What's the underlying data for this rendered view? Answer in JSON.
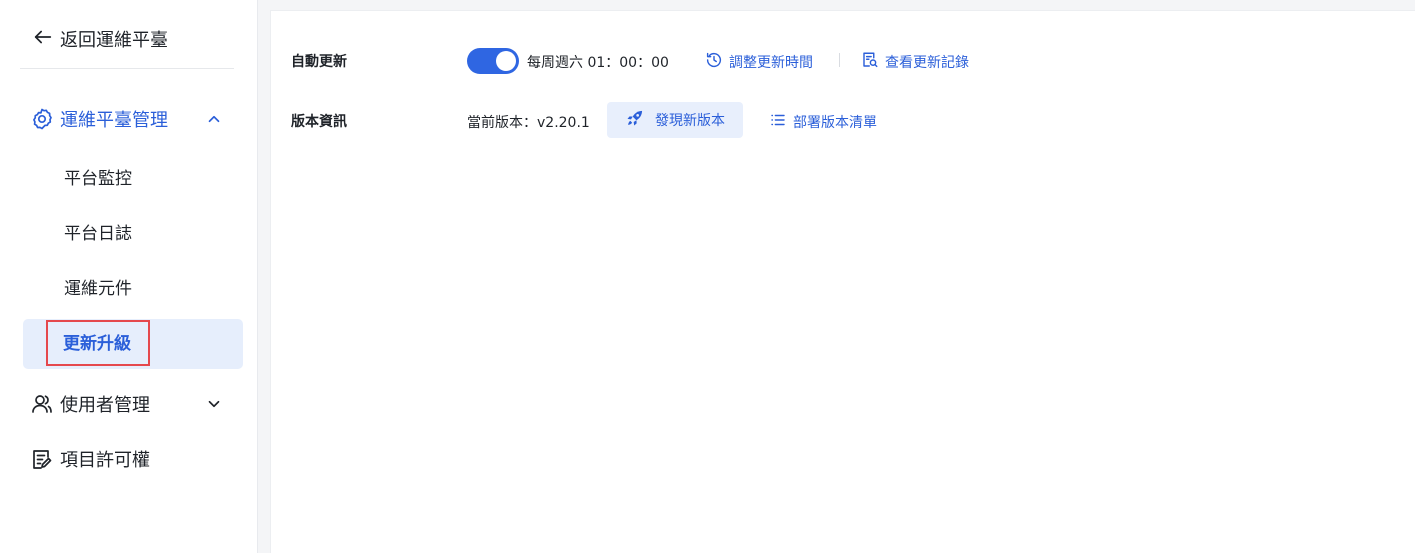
{
  "sidebar": {
    "back_label": "返回運維平臺",
    "groups": [
      {
        "label": "運維平臺管理",
        "icon": "gear-icon",
        "expanded": true
      },
      {
        "label": "使用者管理",
        "icon": "users-icon",
        "expanded": false
      },
      {
        "label": "項目許可權",
        "icon": "license-edit-icon",
        "expanded": null
      }
    ],
    "sub_items": [
      {
        "label": "平台監控"
      },
      {
        "label": "平台日誌"
      },
      {
        "label": "運維元件"
      },
      {
        "label": "更新升級",
        "active": true
      }
    ]
  },
  "main": {
    "auto_update": {
      "label": "自動更新",
      "enabled": true,
      "schedule": "每周週六 01：00：00",
      "adjust_link": "調整更新時間",
      "history_link": "查看更新記錄"
    },
    "version_info": {
      "label": "版本資訊",
      "current": "當前版本：v2.20.1",
      "new_version_button": "發現新版本",
      "deploy_list_link": "部署版本清單"
    }
  },
  "colors": {
    "accent": "#2b5fd9",
    "toggle_on": "#2f66e2",
    "active_bg": "#e6eefc",
    "highlight_box": "#e5484d"
  }
}
